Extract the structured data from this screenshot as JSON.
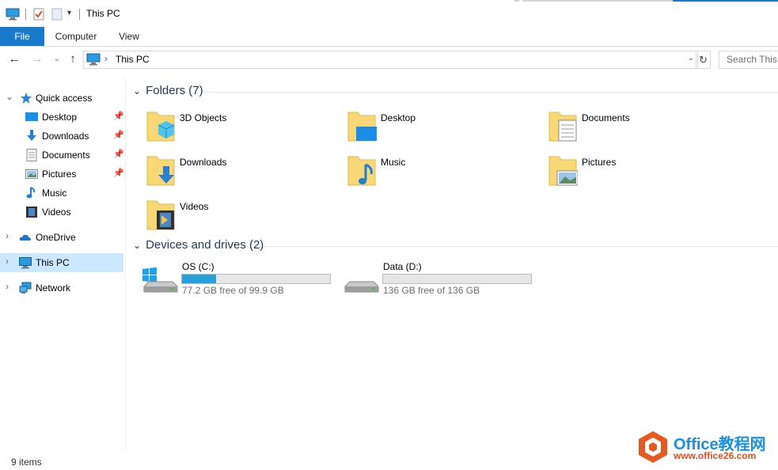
{
  "window": {
    "title": "This PC"
  },
  "ribbon": {
    "tabs": [
      {
        "label": "File"
      },
      {
        "label": "Computer"
      },
      {
        "label": "View"
      }
    ]
  },
  "address": {
    "path": "This PC",
    "search_placeholder": "Search This PC"
  },
  "sidebar": {
    "items": [
      {
        "label": "Quick access",
        "icon": "star-icon"
      },
      {
        "label": "Desktop",
        "icon": "desktop-icon",
        "pinned": true
      },
      {
        "label": "Downloads",
        "icon": "download-icon",
        "pinned": true
      },
      {
        "label": "Documents",
        "icon": "document-icon",
        "pinned": true
      },
      {
        "label": "Pictures",
        "icon": "picture-icon",
        "pinned": true
      },
      {
        "label": "Music",
        "icon": "music-icon"
      },
      {
        "label": "Videos",
        "icon": "video-icon"
      },
      {
        "label": "OneDrive",
        "icon": "cloud-icon"
      },
      {
        "label": "This PC",
        "icon": "computer-icon",
        "selected": true
      },
      {
        "label": "Network",
        "icon": "network-icon"
      }
    ]
  },
  "folders": {
    "heading": "Folders (7)",
    "items": [
      {
        "label": "3D Objects",
        "icon": "3d-objects-folder-icon"
      },
      {
        "label": "Desktop",
        "icon": "desktop-folder-icon"
      },
      {
        "label": "Documents",
        "icon": "documents-folder-icon"
      },
      {
        "label": "Downloads",
        "icon": "downloads-folder-icon"
      },
      {
        "label": "Music",
        "icon": "music-folder-icon"
      },
      {
        "label": "Pictures",
        "icon": "pictures-folder-icon"
      },
      {
        "label": "Videos",
        "icon": "videos-folder-icon"
      }
    ]
  },
  "drives": {
    "heading": "Devices and drives (2)",
    "items": [
      {
        "label": "OS (C:)",
        "free_text": "77.2 GB free of 99.9 GB",
        "used_fraction": 0.23
      },
      {
        "label": "Data (D:)",
        "free_text": "136 GB free of 136 GB",
        "used_fraction": 0.0
      }
    ]
  },
  "status": {
    "items_text": "9 items"
  },
  "watermark": {
    "line1": "Office教程网",
    "line2": "www.office26.com"
  },
  "colors": {
    "accent": "#1979ca",
    "selected_bg": "#cce8ff",
    "drive_fill": "#26a0da",
    "folder_yellow": "#f8d775"
  }
}
